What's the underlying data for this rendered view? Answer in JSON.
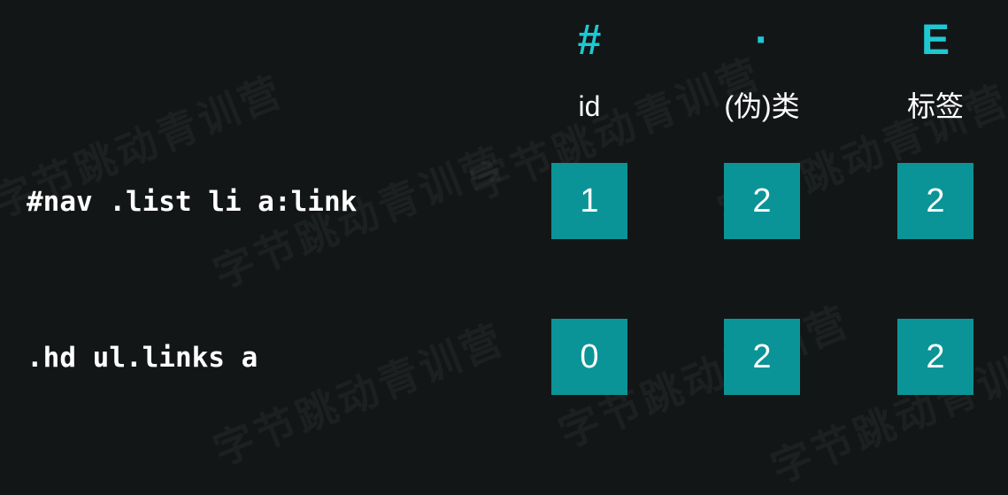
{
  "watermark": "字节跳动青训营",
  "colors": {
    "background": "#131617",
    "accent": "#1ec8d1",
    "box": "#0b9497",
    "text": "#ffffff"
  },
  "columns": [
    {
      "symbol": "#",
      "label": "id"
    },
    {
      "symbol": "·",
      "label": "(伪)类"
    },
    {
      "symbol": "E",
      "label": "标签"
    }
  ],
  "rows": [
    {
      "selector": "#nav .list li a:link",
      "values": [
        "1",
        "2",
        "2"
      ]
    },
    {
      "selector": ".hd ul.links a",
      "values": [
        "0",
        "2",
        "2"
      ]
    }
  ]
}
